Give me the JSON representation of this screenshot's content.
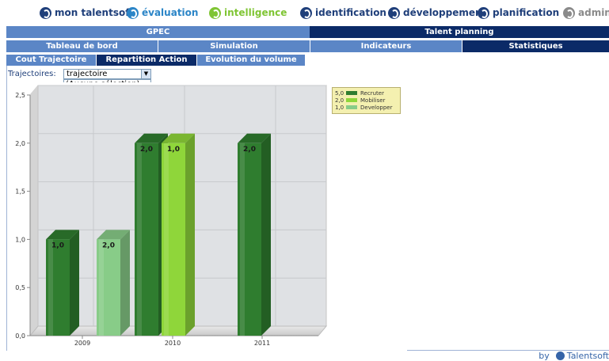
{
  "nav": {
    "items": [
      {
        "label": "mon talentsoft",
        "color": "#1f3f7a",
        "logo": "#1f3f7a"
      },
      {
        "label": "évaluation",
        "color": "#2b85c7",
        "logo": "#2b85c7"
      },
      {
        "label": "intelligence",
        "color": "#7fc534",
        "logo": "#7fc534"
      },
      {
        "label": "identification",
        "color": "#1f3f7a",
        "logo": "#1f3f7a"
      },
      {
        "label": "développement",
        "color": "#1f3f7a",
        "logo": "#1f3f7a"
      },
      {
        "label": "planification",
        "color": "#1f3f7a",
        "logo": "#1f3f7a"
      },
      {
        "label": "admin",
        "color": "#8a8a8a",
        "logo": "#8a8a8a"
      }
    ]
  },
  "modules": {
    "gpec": "GPEC",
    "talent": "Talent planning"
  },
  "subnav": {
    "tableau": "Tableau de bord",
    "simulation": "Simulation",
    "indicateurs": "Indicateurs",
    "statistiques": "Statistiques"
  },
  "tabs": {
    "cout": "Cout Trajectoire",
    "repartition": "Repartition Action",
    "evolution": "Evolution du volume"
  },
  "filter": {
    "label": "Trajectoires:",
    "selected": "trajectoire",
    "options": [
      "(Aucune sélection)",
      "trajectoire"
    ]
  },
  "legend": [
    {
      "value": "5,0",
      "label": "Recruter",
      "color": "#2f7d2f"
    },
    {
      "value": "2,0",
      "label": "Mobiliser",
      "color": "#8fd63a"
    },
    {
      "value": "1,0",
      "label": "Developper",
      "color": "#88cc88"
    }
  ],
  "footer": {
    "by": "by",
    "brand": "Talentsoft"
  },
  "chart_data": {
    "type": "bar",
    "categories": [
      "2009",
      "2010",
      "2011"
    ],
    "series": [
      {
        "name": "Recruter",
        "values": [
          1.0,
          2.0,
          2.0
        ],
        "color": "#2f7d2f"
      },
      {
        "name": "Mobiliser",
        "values": [
          null,
          2.0,
          null
        ],
        "color": "#8fd63a"
      },
      {
        "name": "Developper",
        "values": [
          1.0,
          null,
          null
        ],
        "color": "#88cc88"
      }
    ],
    "bar_labels": [
      "1,0",
      "2,0",
      "2,0",
      "1,0",
      "2,0"
    ],
    "yticks": [
      "0,0",
      "0,5",
      "1,0",
      "1,5",
      "2,0",
      "2,5"
    ],
    "ylim": [
      0,
      2.5
    ],
    "grid": true,
    "legend_position": "top-right"
  }
}
